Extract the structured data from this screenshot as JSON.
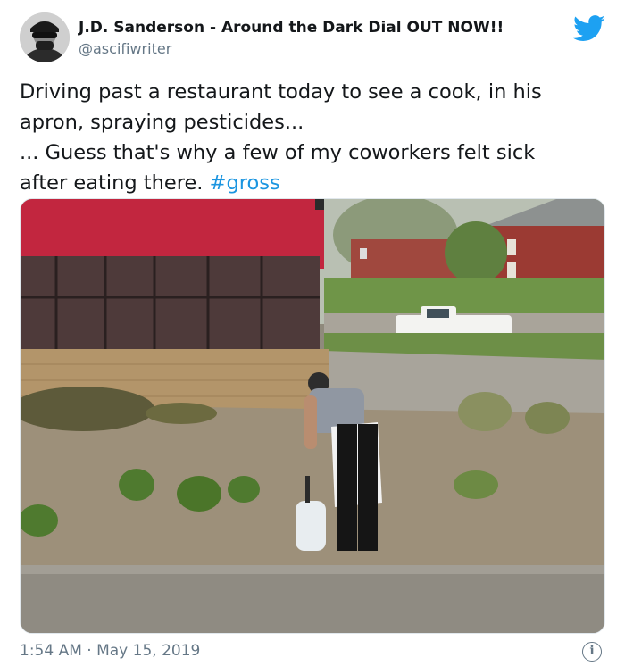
{
  "tweet": {
    "author_name": "J.D. Sanderson - Around the Dark Dial OUT NOW!!",
    "author_handle": "@ascifiwriter",
    "text_lines": [
      "Driving past a restaurant today to see a cook, in his",
      "apron, spraying pesticides...",
      "... Guess that's why a few of my coworkers felt sick",
      "after eating there. "
    ],
    "hashtag": "#gross",
    "timestamp": "1:54 AM · May 15, 2019",
    "info_label": "i",
    "icons": {
      "platform": "twitter-bird-icon",
      "info": "info-icon"
    }
  },
  "colors": {
    "brand": "#1da1f2",
    "hashtag": "#1b95e0",
    "secondary_text": "#657786"
  }
}
